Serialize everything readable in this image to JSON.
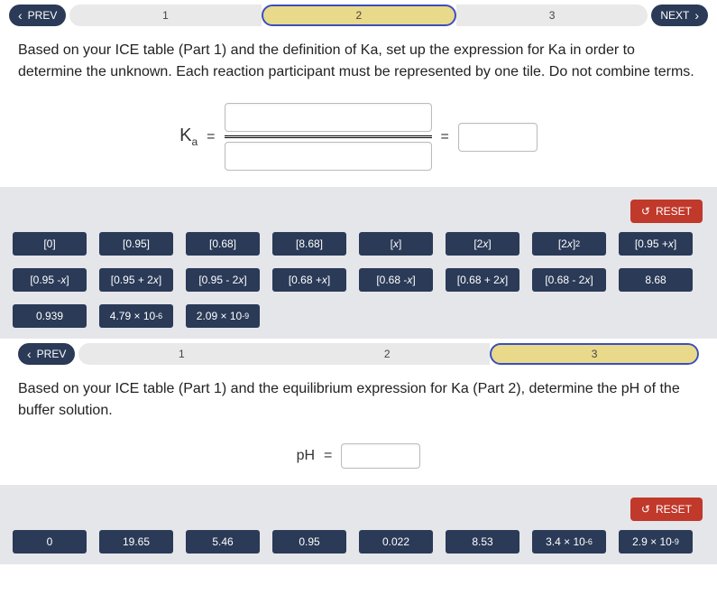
{
  "part2": {
    "nav": {
      "prev": "PREV",
      "next": "NEXT",
      "steps": [
        "1",
        "2",
        "3"
      ],
      "active": 1
    },
    "question": "Based on your ICE table (Part 1) and the definition of Ka, set up the expression for Ka in order to determine the unknown. Each reaction participant must be represented by one tile. Do not combine terms.",
    "ka_label_base": "K",
    "ka_label_sub": "a",
    "equals": "=",
    "reset": "RESET",
    "tiles": [
      {
        "t": "[0]"
      },
      {
        "t": "[0.95]"
      },
      {
        "t": "[0.68]"
      },
      {
        "t": "[8.68]"
      },
      {
        "h": "[<i>x</i>]"
      },
      {
        "h": "[2<i>x</i>]"
      },
      {
        "h": "[2<i>x</i>]<sup>2</sup>"
      },
      {
        "h": "[0.95 + <i>x</i>]"
      },
      {
        "h": "[0.95 - <i>x</i>]"
      },
      {
        "h": "[0.95 + 2<i>x</i>]"
      },
      {
        "h": "[0.95 - 2<i>x</i>]"
      },
      {
        "h": "[0.68 + <i>x</i>]"
      },
      {
        "h": "[0.68 - <i>x</i>]"
      },
      {
        "h": "[0.68 + 2<i>x</i>]"
      },
      {
        "h": "[0.68 - 2<i>x</i>]"
      },
      {
        "t": "8.68"
      },
      {
        "t": "0.939"
      },
      {
        "h": "4.79 × 10<sup>-6</sup>"
      },
      {
        "h": "2.09 × 10<sup>-9</sup>"
      }
    ]
  },
  "part3": {
    "nav": {
      "prev": "PREV",
      "steps": [
        "1",
        "2",
        "3"
      ],
      "active": 2
    },
    "question": "Based on your ICE table (Part 1) and the equilibrium expression for Ka (Part 2), determine the pH of the buffer solution.",
    "ph_label": "pH",
    "equals": "=",
    "reset": "RESET",
    "tiles": [
      {
        "t": "0"
      },
      {
        "t": "19.65"
      },
      {
        "t": "5.46"
      },
      {
        "t": "0.95"
      },
      {
        "t": "0.022"
      },
      {
        "t": "8.53"
      },
      {
        "h": "3.4 × 10<sup>-6</sup>"
      },
      {
        "h": "2.9 × 10<sup>-9</sup>"
      }
    ]
  }
}
